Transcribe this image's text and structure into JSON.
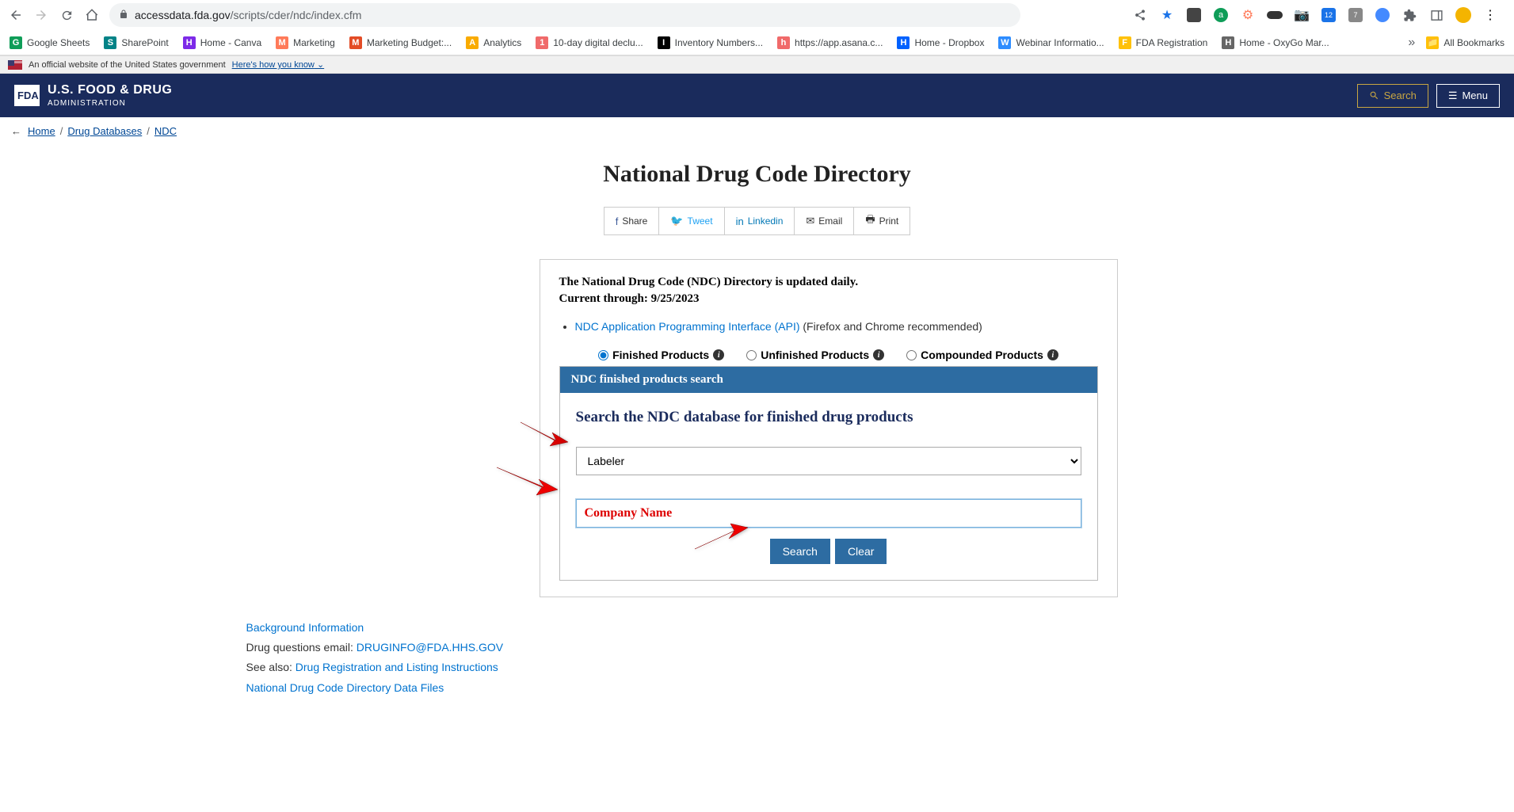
{
  "browser": {
    "url_host": "accessdata.fda.gov",
    "url_path": "/scripts/cder/ndc/index.cfm"
  },
  "bookmarks": [
    {
      "label": "Google Sheets",
      "color": "#0f9d58"
    },
    {
      "label": "SharePoint",
      "color": "#038387"
    },
    {
      "label": "Home - Canva",
      "color": "#7d2ae8"
    },
    {
      "label": "Marketing",
      "color": "#ff7a59"
    },
    {
      "label": "Marketing Budget:...",
      "color": "#e34c26"
    },
    {
      "label": "Analytics",
      "color": "#f9ab00"
    },
    {
      "label": "10-day digital declu...",
      "color": "#f06a6a"
    },
    {
      "label": "Inventory Numbers...",
      "color": "#000"
    },
    {
      "label": "https://app.asana.c...",
      "color": "#f06a6a"
    },
    {
      "label": "Home - Dropbox",
      "color": "#0061fe"
    },
    {
      "label": "Webinar Informatio...",
      "color": "#2d8cff"
    },
    {
      "label": "FDA Registration",
      "color": "#ffc107"
    },
    {
      "label": "Home - OxyGo Mar...",
      "color": "#666"
    }
  ],
  "all_bookmarks": "All Bookmarks",
  "gov_banner": {
    "text": "An official website of the United States government",
    "link": "Here's how you know"
  },
  "fda": {
    "logo": "FDA",
    "title": "U.S. FOOD & DRUG",
    "subtitle": "ADMINISTRATION",
    "search_btn": "Search",
    "menu_btn": "Menu"
  },
  "breadcrumbs": {
    "home": "Home",
    "drug_db": "Drug Databases",
    "ndc": "NDC"
  },
  "page_title": "National Drug Code Directory",
  "social": {
    "share": "Share",
    "tweet": "Tweet",
    "linkedin": "Linkedin",
    "email": "Email",
    "print": "Print"
  },
  "info": {
    "updated": "The National Drug Code (NDC) Directory is updated daily.",
    "current": "Current through: 9/25/2023",
    "api_link": "NDC Application Programming Interface (API)",
    "api_note": "(Firefox and Chrome recommended)"
  },
  "radios": {
    "finished": "Finished Products",
    "unfinished": "Unfinished Products",
    "compounded": "Compounded Products"
  },
  "search_panel": {
    "header": "NDC finished products search",
    "heading": "Search the NDC database for finished drug products",
    "select_value": "Labeler",
    "input_value": "Company Name",
    "search_btn": "Search",
    "clear_btn": "Clear"
  },
  "footer": {
    "background": "Background Information",
    "drug_q_label": "Drug questions email: ",
    "drug_q_email": "DRUGINFO@FDA.HHS.GOV",
    "see_also": "See also: ",
    "dril": "Drug Registration and Listing Instructions",
    "data_files": "National Drug Code Directory Data Files"
  }
}
